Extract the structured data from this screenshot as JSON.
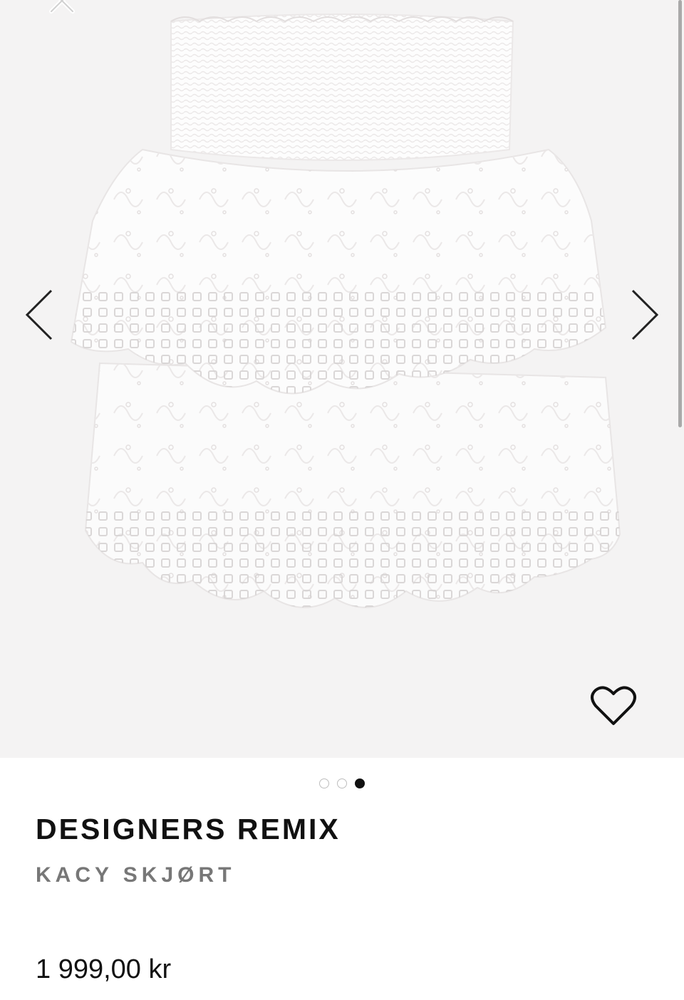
{
  "product": {
    "brand": "DESIGNERS REMIX",
    "name": "KACY SKJØRT",
    "price": "1 999,00 kr"
  },
  "gallery": {
    "image_count": 3,
    "active_index": 2,
    "image_alt": "White embroidered tiered skirt",
    "background_color": "#f4f3f3",
    "icons": {
      "close": "close-icon",
      "previous": "chevron-left-icon",
      "next": "chevron-right-icon",
      "favorite": "heart-outline-icon"
    }
  }
}
